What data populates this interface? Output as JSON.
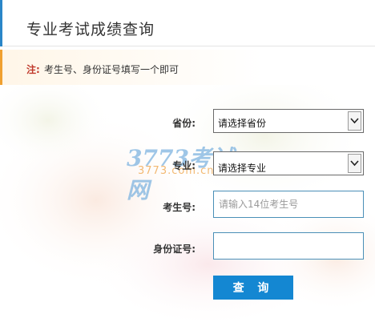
{
  "header": {
    "title": "专业考试成绩查询"
  },
  "notice": {
    "label": "注:",
    "text": "考生号、身份证号填写一个即可"
  },
  "form": {
    "province": {
      "label": "省份:",
      "value": "请选择省份"
    },
    "major": {
      "label": "专业:",
      "value": "请选择专业"
    },
    "exam_no": {
      "label": "考生号:",
      "placeholder": "请输入14位考生号",
      "value": ""
    },
    "id_no": {
      "label": "身份证号:",
      "placeholder": "",
      "value": ""
    },
    "submit_label": "查 询"
  },
  "watermark": {
    "main": "3773考试网",
    "sub": "3773.com.cn"
  },
  "colors": {
    "accent": "#1487d2",
    "note_bar": "#f0a030",
    "note_label": "#c0392b"
  }
}
